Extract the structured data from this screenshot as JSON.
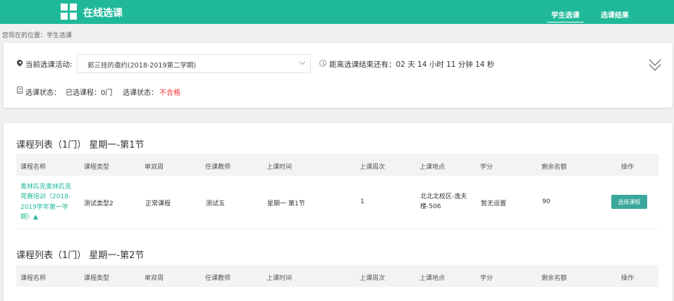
{
  "header": {
    "brand": "在线选课",
    "nav": [
      "学生选课",
      "选课结果"
    ]
  },
  "breadcrumb": "您现在的位置：学生选课",
  "activity": {
    "label": "当前选课活动:",
    "selected": "郭三挂的邀约(2018-2019第二学期)",
    "countdown": "距离选课结束还有：02 天 14 小时 11 分钟 14 秒"
  },
  "status": {
    "label": "选课状态：",
    "selected_courses": "已选课程：0门",
    "label2": "选课状态：",
    "result": "不合格"
  },
  "table": {
    "columns": [
      "课程名称",
      "课程类型",
      "单双周",
      "任课教师",
      "上课时间",
      "上课周次",
      "上课地点",
      "学分",
      "剩余名额",
      "操作"
    ]
  },
  "sections": [
    {
      "title": "课程列表（1门） 星期一-第1节",
      "rows": [
        {
          "name": "奥林匹克奥林匹克竞赛培训（2018-2019学年第一学期）▲",
          "type": "测试类型2",
          "weeks_type": "正常课程",
          "teacher": "测试五",
          "time": "星期一 第1节",
          "week_no": "1",
          "location": "北北北校区-逸夫楼-506",
          "credit": "暂无设置",
          "remaining": "90",
          "action": "选择课程"
        }
      ]
    },
    {
      "title": "课程列表（1门） 星期一-第2节",
      "rows": []
    }
  ]
}
